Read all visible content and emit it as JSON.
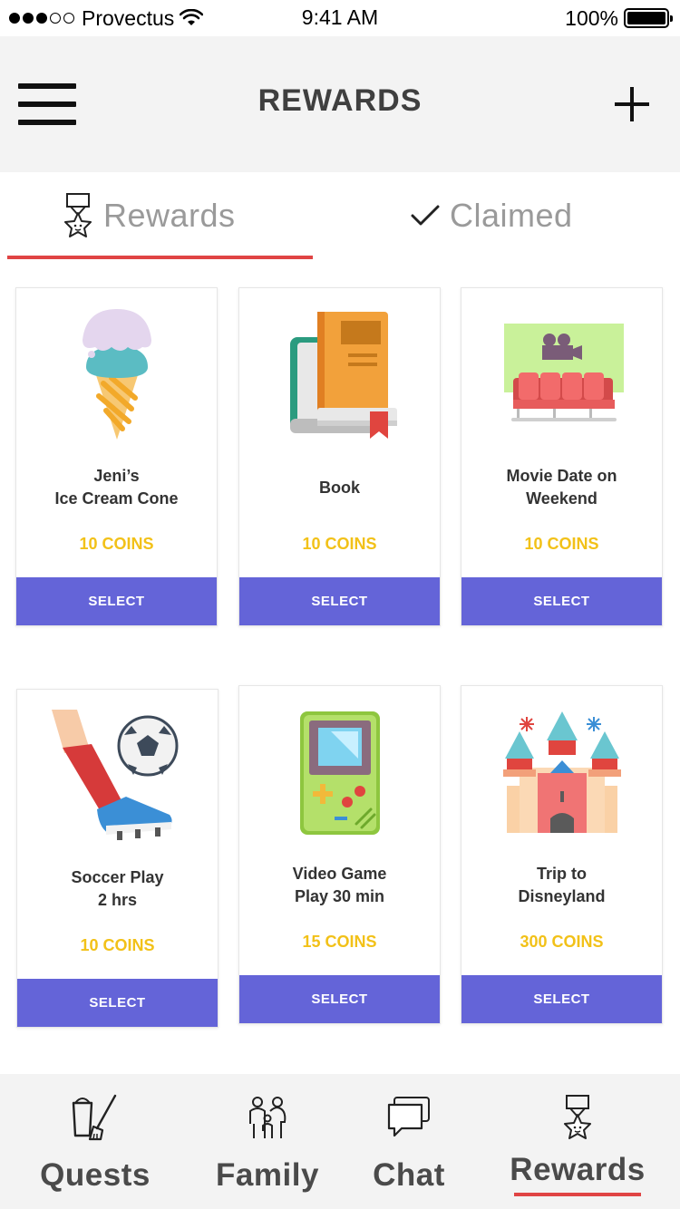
{
  "status_bar": {
    "carrier": "Provectus",
    "time": "9:41 AM",
    "battery": "100%",
    "signal_bars_filled": 3,
    "signal_bars_total": 5
  },
  "header": {
    "title": "REWARDS",
    "menu_icon": "hamburger-menu-icon",
    "add_icon": "plus-icon"
  },
  "tabs": {
    "rewards_label": "Rewards",
    "claimed_label": "Claimed",
    "active": "Rewards"
  },
  "rewards": [
    {
      "title": "Jeni’s\nIce Cream Cone",
      "price": "10 COINS",
      "select_label": "SELECT",
      "icon": "ice-cream-cone-icon"
    },
    {
      "title": "Book",
      "price": "10 COINS",
      "select_label": "SELECT",
      "icon": "book-icon"
    },
    {
      "title": "Movie Date on\nWeekend",
      "price": "10 COINS",
      "select_label": "SELECT",
      "icon": "movie-theater-icon"
    },
    {
      "title": "Soccer Play\n2 hrs",
      "price": "10 COINS",
      "select_label": "SELECT",
      "icon": "soccer-kick-icon"
    },
    {
      "title": "Video Game\nPlay 30 min",
      "price": "15 COINS",
      "select_label": "SELECT",
      "icon": "handheld-game-console-icon"
    },
    {
      "title": "Trip to\nDisneyland",
      "price": "300 COINS",
      "select_label": "SELECT",
      "icon": "castle-icon"
    }
  ],
  "tab_bar": {
    "items": [
      {
        "label": "Quests",
        "icon": "cleaning-bucket-icon"
      },
      {
        "label": "Family",
        "icon": "family-icon"
      },
      {
        "label": "Chat",
        "icon": "chat-bubbles-icon"
      },
      {
        "label": "Rewards",
        "icon": "medal-icon"
      }
    ],
    "active": "Rewards"
  },
  "colors": {
    "accent_red": "#e04444",
    "select_button": "#6464d8",
    "price_yellow": "#f2c118",
    "bar_background": "#f3f3f3"
  }
}
